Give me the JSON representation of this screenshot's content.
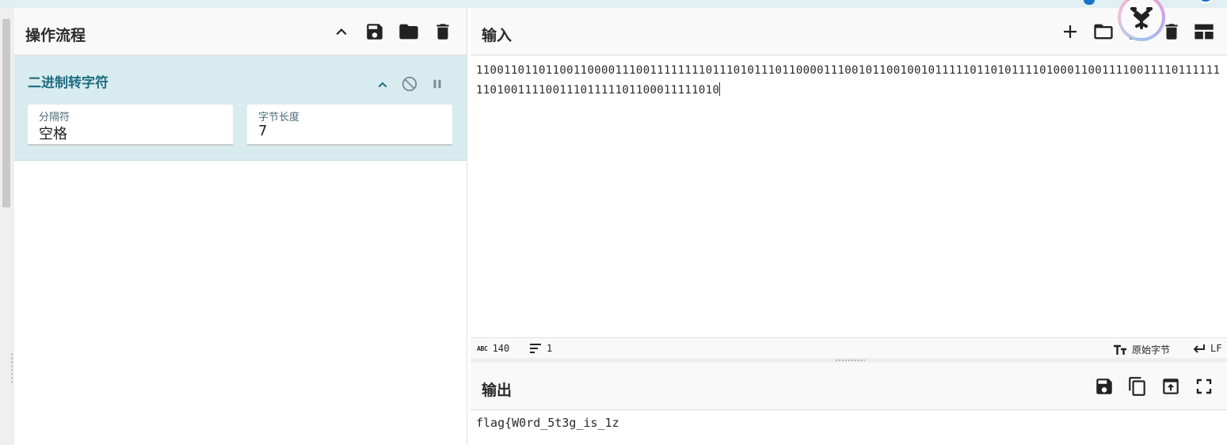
{
  "recipe": {
    "title": "操作流程",
    "operation": {
      "name": "二进制转字符",
      "args": [
        {
          "label": "分隔符",
          "value": "空格"
        },
        {
          "label": "字节长度",
          "value": "7"
        }
      ]
    }
  },
  "input": {
    "title": "输入",
    "text": "1100110110110011000011100111111110111010111011000011100101100100101111101101011110100011001111001111011111111010011110011101111101100011111010"
  },
  "status": {
    "char_count_icon": "abc-icon",
    "char_count": "140",
    "lines_count": "1",
    "encoding": "原始字节",
    "eol": "LF"
  },
  "output": {
    "title": "输出",
    "text": "flag{W0rd_5t3g_is_1z"
  },
  "colors": {
    "accent": "#1e6c80",
    "operation_bg": "#d8ecf0",
    "brand_blue": "#1a73c8"
  }
}
